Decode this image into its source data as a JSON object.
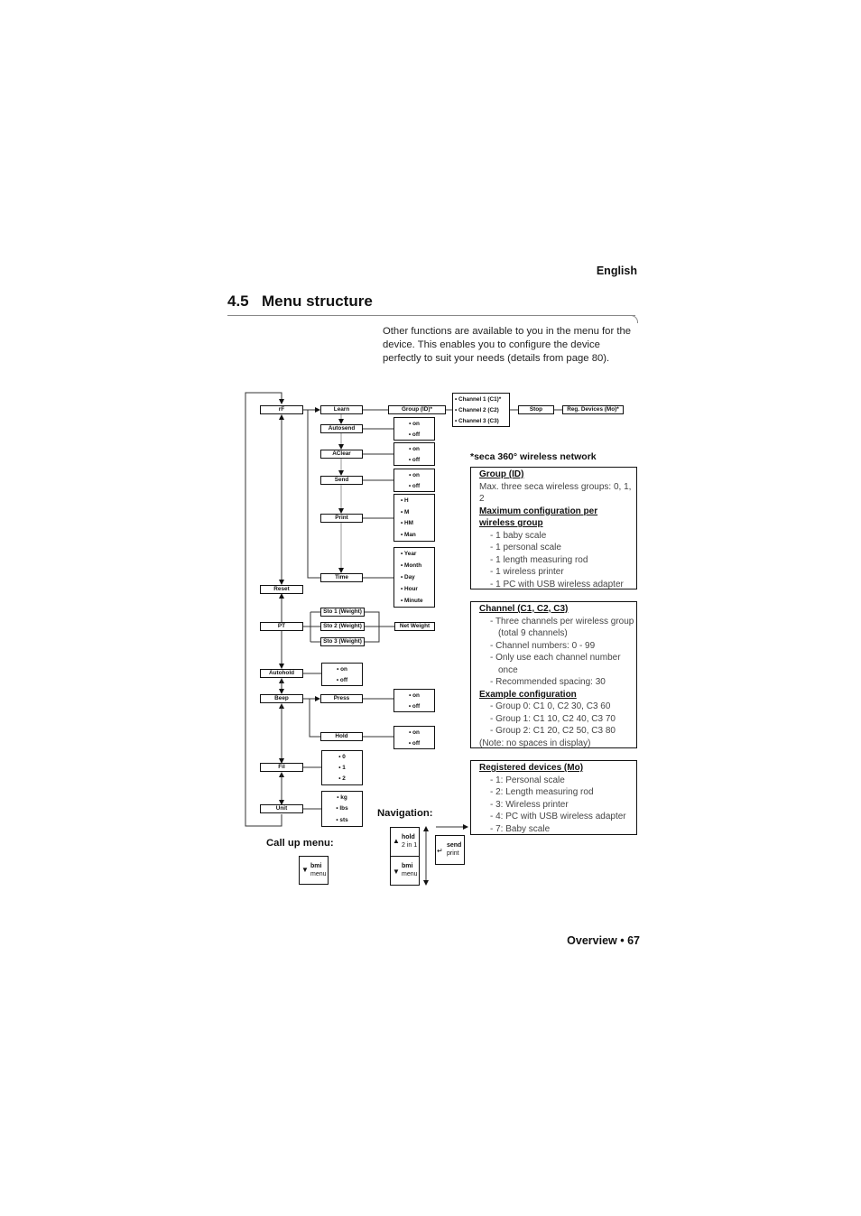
{
  "page": {
    "language": "English",
    "section_number": "4.5",
    "section_title": "Menu structure",
    "intro": "Other functions are available to you in the menu for the device. This enables you to configure the device perfectly to suit your needs (details from page 80).",
    "footer": "Overview • 67"
  },
  "menu": {
    "main": [
      "rF",
      "Reset",
      "PT",
      "Autohold",
      "Beep",
      "Fil",
      "Unit"
    ],
    "rf_sub": [
      "Learn",
      "Autosend",
      "AClear",
      "Send",
      "Print",
      "Time"
    ],
    "group_id": "Group (ID)*",
    "channels": [
      "• Channel 1 (C1)*",
      "• Channel 2 (C2)",
      "• Channel 3 (C3)"
    ],
    "stop": "Stop",
    "reg_devices": "Reg. Devices (Mo)*",
    "on_off": [
      "• on",
      "• off"
    ],
    "print_opts": [
      "• H",
      "• M",
      "• HM",
      "• Man"
    ],
    "time_opts": [
      "• Year",
      "• Month",
      "• Day",
      "• Hour",
      "• Minute"
    ],
    "pt_sub": [
      "Sto 1 (Weight)",
      "Sto 2 (Weight)",
      "Sto 3 (Weight)"
    ],
    "net_weight": "Net Weight",
    "beep_sub": [
      "Press",
      "Hold"
    ],
    "fil_opts": [
      "• 0",
      "• 1",
      "• 2"
    ],
    "unit_opts": [
      "• kg",
      "• lbs",
      "• sts"
    ]
  },
  "notes": {
    "heading": "*seca 360° wireless network",
    "group": {
      "title": "Group (ID)",
      "text": "Max. three seca wireless groups: 0, 1, 2",
      "subtitle": "Maximum configuration per wireless group",
      "items": [
        "1 baby scale",
        "1 personal scale",
        "1 length measuring rod",
        "1 wireless printer",
        "1 PC with USB wireless adapter"
      ]
    },
    "channel": {
      "title": "Channel (C1, C2, C3)",
      "items": [
        "Three channels per wireless group (total 9 channels)",
        "Channel numbers: 0 - 99",
        "Only use each channel number once",
        "Recommended spacing: 30"
      ],
      "subtitle": "Example configuration",
      "examples": [
        "Group 0: C1 0, C2 30, C3 60",
        "Group 1: C1 10, C2 40, C3 70",
        "Group 2: C1 20, C2 50, C3 80"
      ],
      "note": "(Note: no spaces in display)"
    },
    "registered": {
      "title": "Registered devices (Mo)",
      "items": [
        "1: Personal scale",
        "2: Length measuring rod",
        "3: Wireless printer",
        "4: PC with USB wireless adapter",
        "7: Baby scale"
      ]
    }
  },
  "keys": {
    "call_up_label": "Call up menu:",
    "navigation_label": "Navigation:",
    "bmi_menu": [
      "bmi",
      "menu"
    ],
    "hold_2in1": [
      "hold",
      "2 in 1"
    ],
    "send_print": [
      "send",
      "print"
    ],
    "up_arrow": "▲",
    "down_arrow": "▼",
    "enter_arrow": "↵"
  }
}
